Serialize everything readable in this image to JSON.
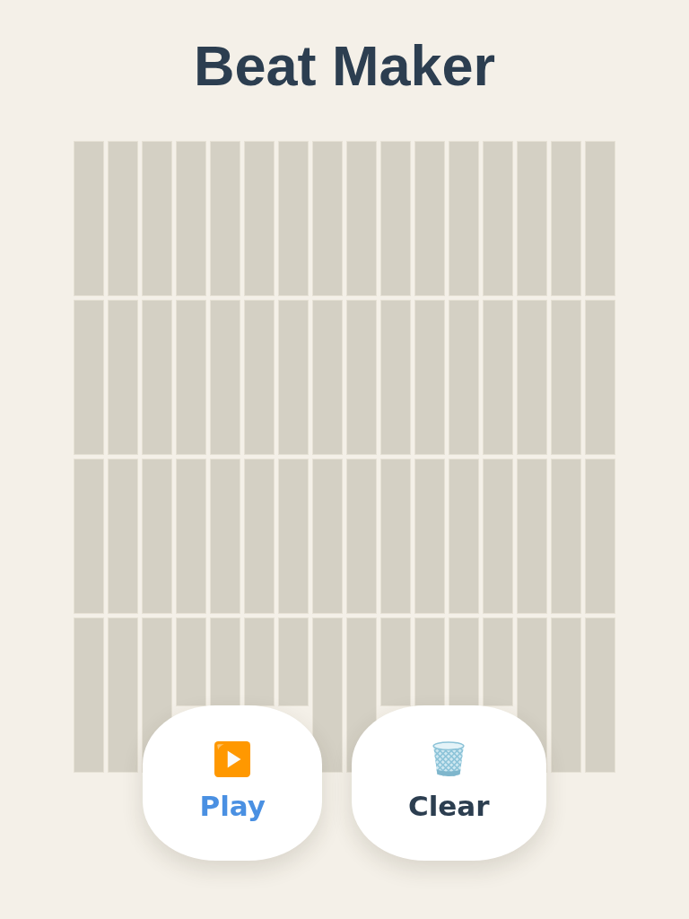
{
  "title": "Beat Maker",
  "grid": {
    "rows": [
      {
        "steps": [
          {
            "active": false
          },
          {
            "active": false
          },
          {
            "active": false
          },
          {
            "active": false
          },
          {
            "active": false
          },
          {
            "active": false
          },
          {
            "active": false
          },
          {
            "active": false
          },
          {
            "active": false
          },
          {
            "active": false
          },
          {
            "active": false
          },
          {
            "active": false
          },
          {
            "active": false
          },
          {
            "active": false
          },
          {
            "active": false
          },
          {
            "active": false
          }
        ]
      },
      {
        "steps": [
          {
            "active": false
          },
          {
            "active": false
          },
          {
            "active": false
          },
          {
            "active": false
          },
          {
            "active": false
          },
          {
            "active": false
          },
          {
            "active": false
          },
          {
            "active": false
          },
          {
            "active": false
          },
          {
            "active": false
          },
          {
            "active": false
          },
          {
            "active": false
          },
          {
            "active": false
          },
          {
            "active": false
          },
          {
            "active": false
          },
          {
            "active": false
          }
        ]
      },
      {
        "steps": [
          {
            "active": false
          },
          {
            "active": false
          },
          {
            "active": false
          },
          {
            "active": false
          },
          {
            "active": false
          },
          {
            "active": false
          },
          {
            "active": false
          },
          {
            "active": false
          },
          {
            "active": false
          },
          {
            "active": false
          },
          {
            "active": false
          },
          {
            "active": false
          },
          {
            "active": false
          },
          {
            "active": false
          },
          {
            "active": false
          },
          {
            "active": false
          }
        ]
      },
      {
        "steps": [
          {
            "active": false
          },
          {
            "active": false
          },
          {
            "active": false
          },
          {
            "active": false
          },
          {
            "active": false
          },
          {
            "active": false
          },
          {
            "active": false
          },
          {
            "active": false
          },
          {
            "active": false
          },
          {
            "active": false
          },
          {
            "active": false
          },
          {
            "active": false
          },
          {
            "active": false
          },
          {
            "active": false
          },
          {
            "active": false
          },
          {
            "active": false
          }
        ]
      }
    ]
  },
  "buttons": [
    {
      "kind": "play",
      "label": "Play"
    },
    {
      "kind": "clear",
      "label": "Clear"
    }
  ]
}
